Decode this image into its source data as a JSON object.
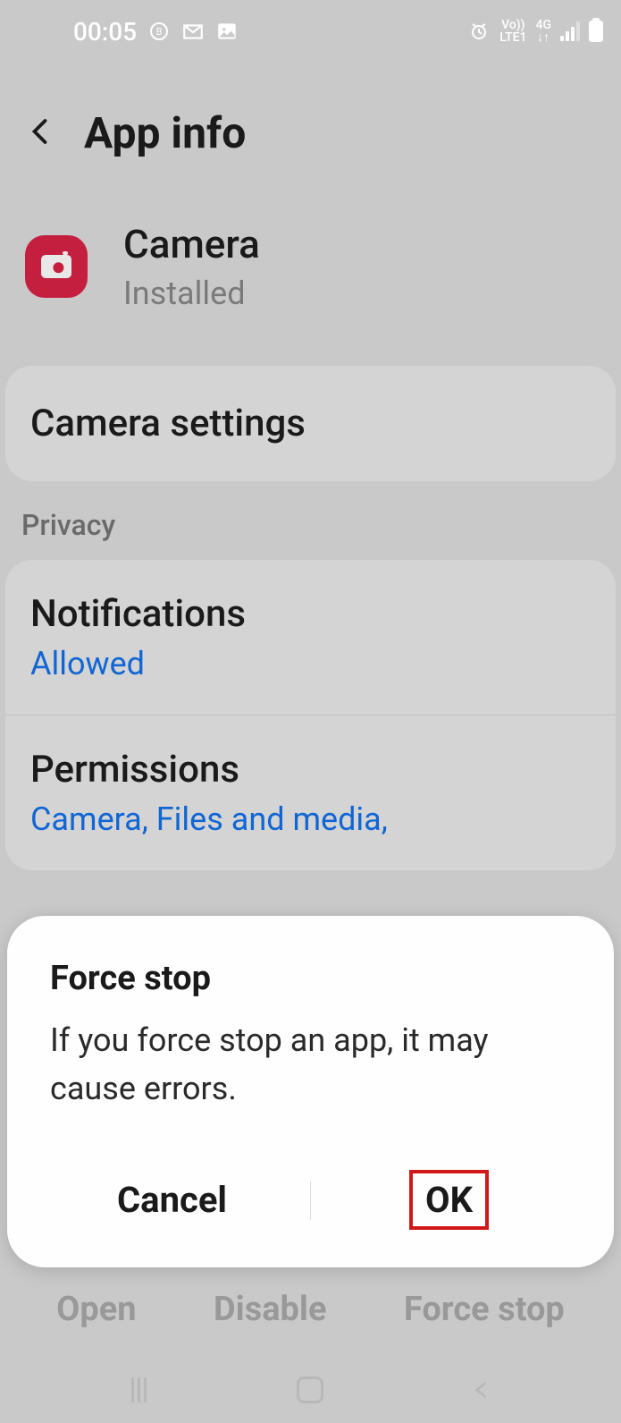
{
  "statusBar": {
    "time": "00:05"
  },
  "header": {
    "title": "App info"
  },
  "app": {
    "name": "Camera",
    "status": "Installed"
  },
  "settingsRow": {
    "label": "Camera settings"
  },
  "sections": {
    "privacy": "Privacy"
  },
  "listItems": {
    "notifications": {
      "title": "Notifications",
      "value": "Allowed"
    },
    "permissions": {
      "title": "Permissions",
      "value": "Camera, Files and media,"
    }
  },
  "dialog": {
    "title": "Force stop",
    "message": "If you force stop an app, it may cause errors.",
    "cancel": "Cancel",
    "ok": "OK"
  },
  "bottomActions": {
    "open": "Open",
    "disable": "Disable",
    "forceStop": "Force stop"
  }
}
